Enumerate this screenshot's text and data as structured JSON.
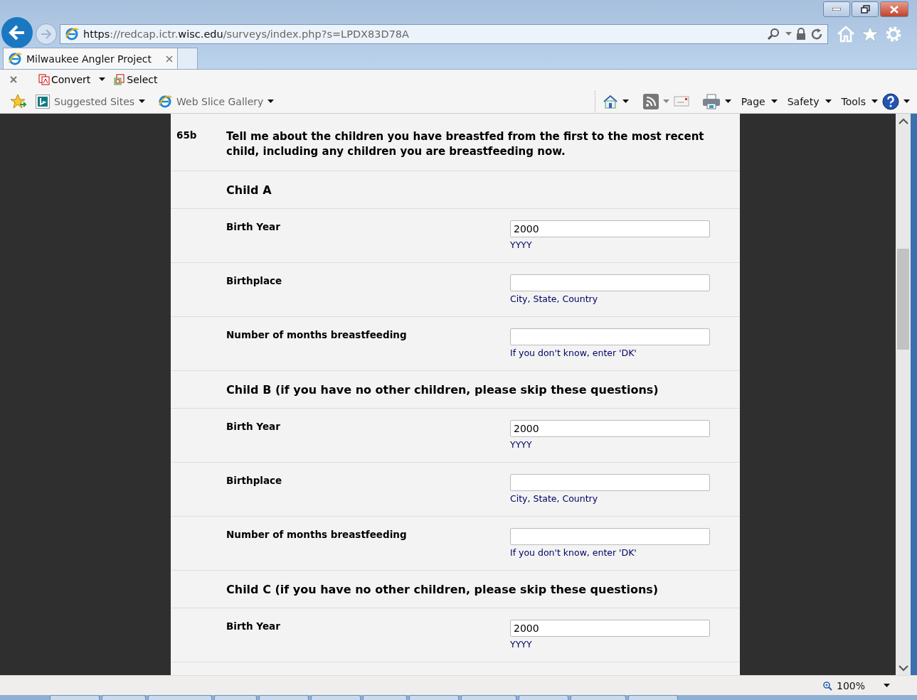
{
  "address_bar": {
    "url_parts": [
      {
        "text": "https",
        "emphasis": true
      },
      {
        "text": "://redcap.ictr.",
        "emphasis": false
      },
      {
        "text": "wisc.edu",
        "emphasis": true
      },
      {
        "text": "/surveys/index.php?s=LPDX83D78A",
        "emphasis": false
      }
    ]
  },
  "tabs": [
    {
      "label": "Milwaukee Angler Project",
      "selected": true
    }
  ],
  "command_bar": {
    "items": [
      {
        "label": "Convert",
        "kind": "convert"
      },
      {
        "label": "Select",
        "kind": "select"
      }
    ]
  },
  "favorites_bar": {
    "items": [
      {
        "label": "Suggested Sites",
        "kind": "bing"
      },
      {
        "label": "Web Slice Gallery",
        "kind": "webslice"
      }
    ],
    "menus": [
      {
        "label": "Page"
      },
      {
        "label": "Safety"
      },
      {
        "label": "Tools"
      }
    ]
  },
  "survey": {
    "question": {
      "number": "65b",
      "text": "Tell me about the children you have breastfed from the first to the most recent child, including any children you are breastfeeding now."
    },
    "rows": [
      {
        "kind": "header",
        "label": "Child A"
      },
      {
        "kind": "field",
        "label": "Birth Year",
        "value": "2000",
        "note": "YYYY"
      },
      {
        "kind": "field",
        "label": "Birthplace",
        "note": "City, State, Country"
      },
      {
        "kind": "field",
        "label": "Number of months breastfeeding",
        "note": "If you don't know, enter 'DK'"
      },
      {
        "kind": "header",
        "label": "Child B (if you have no other children, please skip these questions)"
      },
      {
        "kind": "field",
        "label": "Birth Year",
        "value": "2000",
        "note": "YYYY"
      },
      {
        "kind": "field",
        "label": "Birthplace",
        "note": "City, State, Country"
      },
      {
        "kind": "field",
        "label": "Number of months breastfeeding",
        "note": "If you don't know, enter 'DK'"
      },
      {
        "kind": "header",
        "label": "Child C (if you have no other children, please skip these questions)"
      },
      {
        "kind": "field",
        "label": "Birth Year",
        "value": "2000",
        "note": "YYYY"
      }
    ]
  },
  "status_bar": {
    "zoom": "100%"
  }
}
